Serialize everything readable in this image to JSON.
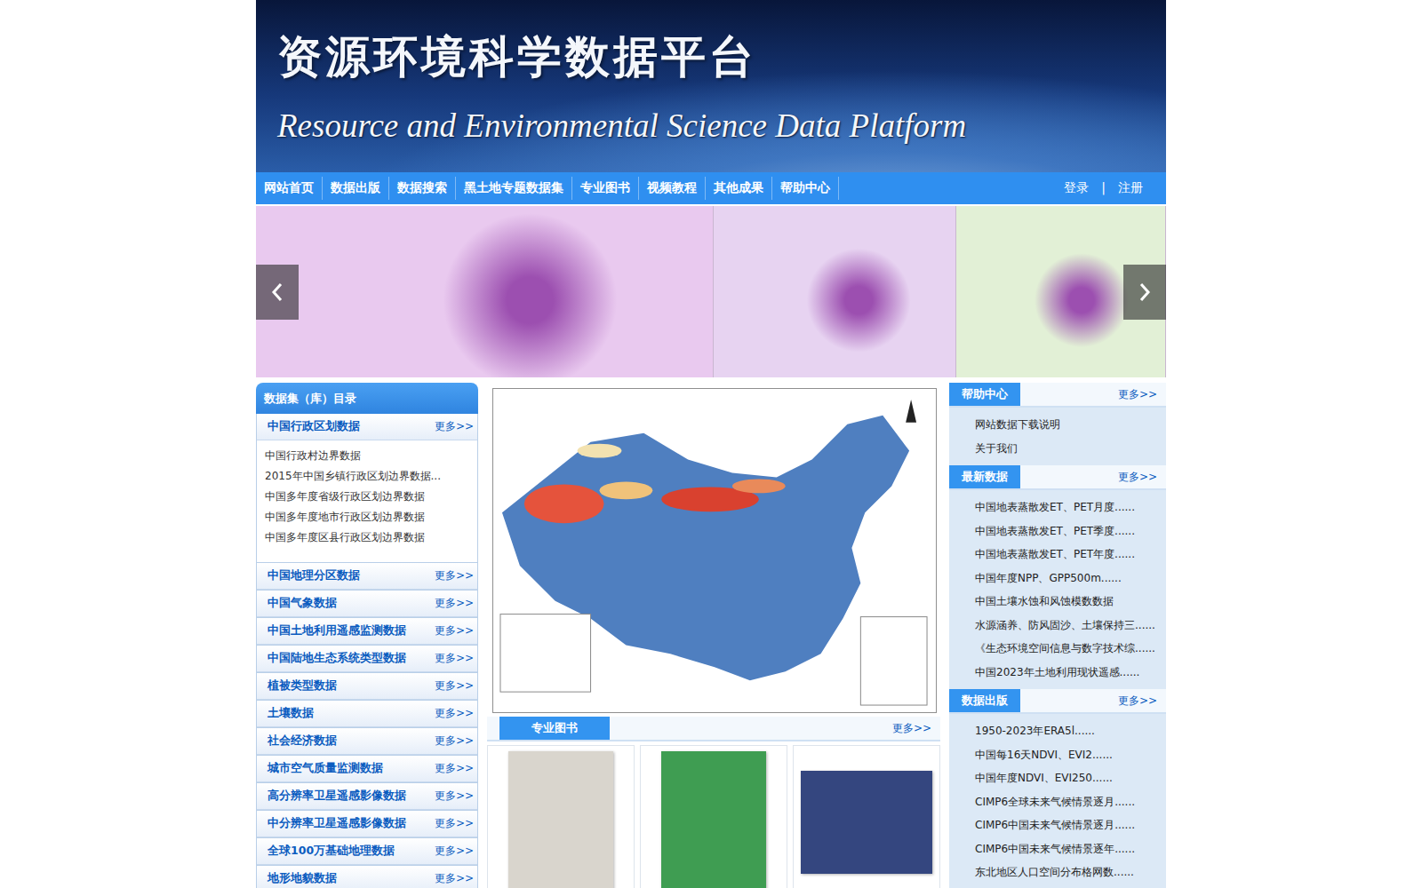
{
  "header": {
    "title": "资源环境科学数据平台",
    "subtitle": "Resource and Environmental Science Data Platform"
  },
  "nav": {
    "items": [
      "网站首页",
      "数据出版",
      "数据搜索",
      "黑土地专题数据集",
      "专业图书",
      "视频教程",
      "其他成果",
      "帮助中心"
    ],
    "login": "登录",
    "divider": "|",
    "register": "注册"
  },
  "carousel": {
    "slides": [
      {
        "color": "#e9c9ef"
      },
      {
        "color": "#e7d3f1"
      },
      {
        "color": "#e2f0d6"
      }
    ]
  },
  "more": "更多>>",
  "catalog": {
    "title": "数据集（库）目录",
    "groups": [
      {
        "name": "中国行政区划数据",
        "expanded": true,
        "items": [
          "中国行政村边界数据",
          "2015年中国乡镇行政区划边界数据...",
          "中国多年度省级行政区划边界数据",
          "中国多年度地市行政区划边界数据",
          "中国多年度区县行政区划边界数据"
        ]
      },
      {
        "name": "中国地理分区数据",
        "expanded": false,
        "items": []
      },
      {
        "name": "中国气象数据",
        "expanded": false,
        "items": []
      },
      {
        "name": "中国土地利用遥感监测数据",
        "expanded": false,
        "items": []
      },
      {
        "name": "中国陆地生态系统类型数据",
        "expanded": false,
        "items": []
      },
      {
        "name": "植被类型数据",
        "expanded": false,
        "items": []
      },
      {
        "name": "土壤数据",
        "expanded": false,
        "items": []
      },
      {
        "name": "社会经济数据",
        "expanded": false,
        "items": []
      },
      {
        "name": "城市空气质量监测数据",
        "expanded": false,
        "items": []
      },
      {
        "name": "高分辨率卫星遥感影像数据",
        "expanded": false,
        "items": []
      },
      {
        "name": "中分辨率卫星遥感影像数据",
        "expanded": false,
        "items": []
      },
      {
        "name": "全球100万基础地理数据",
        "expanded": false,
        "items": []
      },
      {
        "name": "地形地貌数据",
        "expanded": false,
        "items": []
      }
    ]
  },
  "books": {
    "title": "专业图书",
    "items": [
      {
        "color": "#d9d5cd"
      },
      {
        "color": "#3f9d52"
      },
      {
        "color": "#34467f"
      }
    ]
  },
  "side": [
    {
      "title": "帮助中心",
      "items": [
        "网站数据下载说明",
        "关于我们"
      ]
    },
    {
      "title": "最新数据",
      "items": [
        "中国地表蒸散发ET、PET月度......",
        "中国地表蒸散发ET、PET季度......",
        "中国地表蒸散发ET、PET年度......",
        "中国年度NPP、GPP500m......",
        "中国土壤水蚀和风蚀模数数据",
        "水源涵养、防风固沙、土壤保持三......",
        "《生态环境空间信息与数字技术综......",
        "中国2023年土地利用现状遥感......"
      ]
    },
    {
      "title": "数据出版",
      "items": [
        "1950-2023年ERA5l......",
        "中国每16天NDVI、EVI2......",
        "中国年度NDVI、EVI250......",
        "CIMP6全球未来气候情景逐月......",
        "CIMP6中国未来气候情景逐月......",
        "CIMP6中国未来气候情景逐年......",
        "东北地区人口空间分布格网数......"
      ]
    }
  ]
}
